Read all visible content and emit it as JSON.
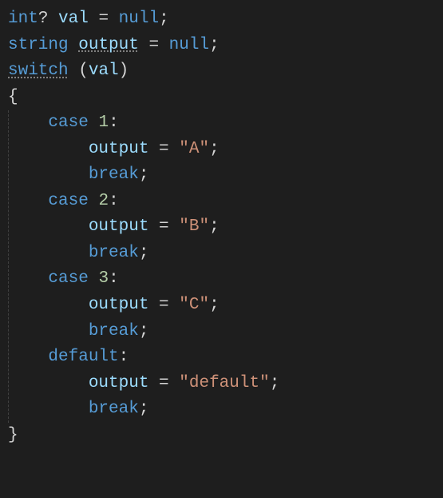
{
  "l1": {
    "t_int": "int",
    "qmark": "?",
    "sp": " ",
    "var_val": "val",
    "eq": " = ",
    "null": "null",
    "semi": ";"
  },
  "l2": {
    "t_str": "string",
    "sp": " ",
    "var_out": "output",
    "eq": " = ",
    "null": "null",
    "semi": ";"
  },
  "l3": {
    "switch": "switch",
    "sp": " ",
    "lp": "(",
    "var_val": "val",
    "rp": ")"
  },
  "l4": {
    "brace": "{"
  },
  "case1": {
    "indent": "    ",
    "case": "case",
    "sp": " ",
    "num": "1",
    "colon": ":"
  },
  "case1a": {
    "indent": "        ",
    "var": "output",
    "eq": " = ",
    "str": "\"A\"",
    "semi": ";"
  },
  "case1b": {
    "indent": "        ",
    "break": "break",
    "semi": ";"
  },
  "case2": {
    "indent": "    ",
    "case": "case",
    "sp": " ",
    "num": "2",
    "colon": ":"
  },
  "case2a": {
    "indent": "        ",
    "var": "output",
    "eq": " = ",
    "str": "\"B\"",
    "semi": ";"
  },
  "case2b": {
    "indent": "        ",
    "break": "break",
    "semi": ";"
  },
  "case3": {
    "indent": "    ",
    "case": "case",
    "sp": " ",
    "num": "3",
    "colon": ":"
  },
  "case3a": {
    "indent": "        ",
    "var": "output",
    "eq": " = ",
    "str": "\"C\"",
    "semi": ";"
  },
  "case3b": {
    "indent": "        ",
    "break": "break",
    "semi": ";"
  },
  "def": {
    "indent": "    ",
    "default": "default",
    "colon": ":"
  },
  "defa": {
    "indent": "        ",
    "var": "output",
    "eq": " = ",
    "str": "\"default\"",
    "semi": ";"
  },
  "defb": {
    "indent": "        ",
    "break": "break",
    "semi": ";"
  },
  "l_end": {
    "brace": "}"
  },
  "chart_data": {
    "type": "table",
    "title": "C# switch statement code snippet",
    "code": "int? val = null;\nstring output = null;\nswitch (val)\n{\n    case 1:\n        output = \"A\";\n        break;\n    case 2:\n        output = \"B\";\n        break;\n    case 3:\n        output = \"C\";\n        break;\n    default:\n        output = \"default\";\n        break;\n}",
    "language": "csharp"
  }
}
